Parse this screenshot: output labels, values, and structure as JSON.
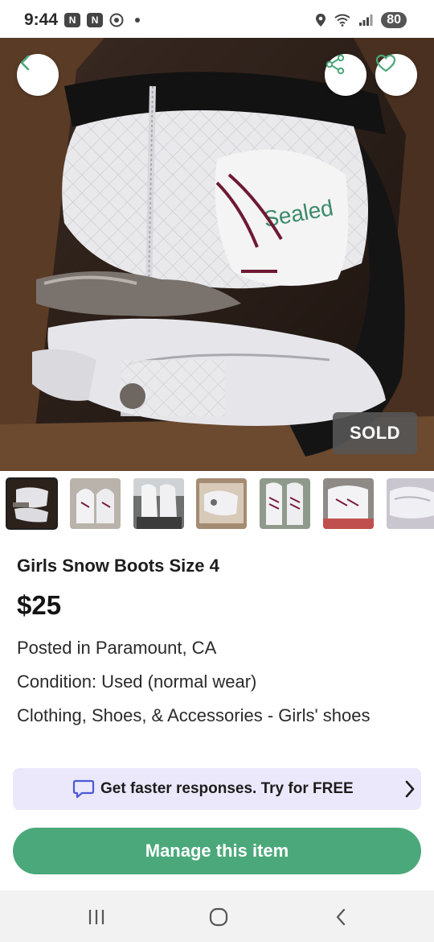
{
  "status_bar": {
    "time": "9:44",
    "battery": "80",
    "icons": [
      "notification-icon",
      "notification-icon",
      "chrome-icon",
      "location-icon",
      "wifi-icon",
      "signal-icon"
    ]
  },
  "hero": {
    "sold_label": "SOLD",
    "icons": {
      "back": "chevron-left-icon",
      "share": "share-icon",
      "like": "heart-icon"
    }
  },
  "thumbnails": [
    {
      "selected": true
    },
    {
      "selected": false
    },
    {
      "selected": false
    },
    {
      "selected": false
    },
    {
      "selected": false
    },
    {
      "selected": false
    },
    {
      "selected": false
    }
  ],
  "listing": {
    "title": "Girls Snow Boots Size 4",
    "price": "$25",
    "posted": "Posted in Paramount, CA",
    "condition": "Condition: Used (normal wear)",
    "category": "Clothing, Shoes, & Accessories - Girls' shoes"
  },
  "promo": {
    "text": "Get faster responses. Try for FREE"
  },
  "actions": {
    "manage_label": "Manage this item"
  },
  "colors": {
    "accent_green": "#4ba87a",
    "promo_bg": "#ece8fb",
    "promo_icon": "#4a5ad6"
  }
}
